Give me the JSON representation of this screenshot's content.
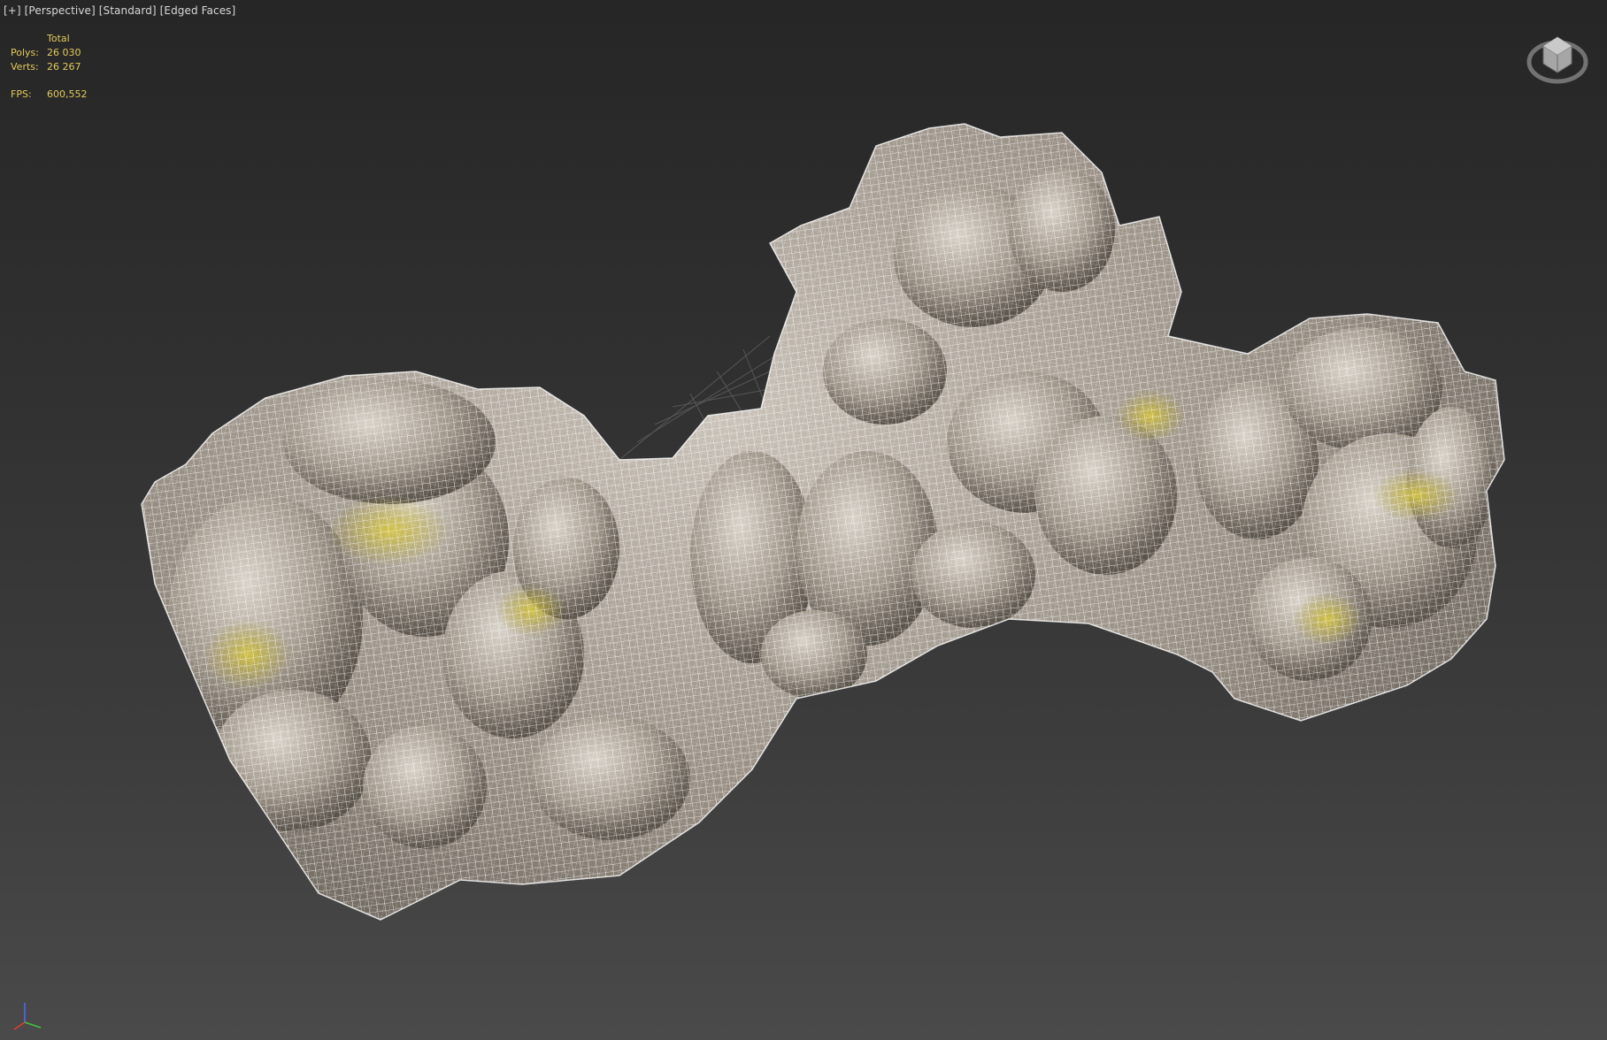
{
  "viewport": {
    "label_plus": "[+]",
    "label_view": "[Perspective]",
    "label_shading": "[Standard]",
    "label_display": "[Edged Faces]"
  },
  "stats": {
    "header": "Total",
    "polys_label": "Polys:",
    "polys_value": "26 030",
    "verts_label": "Verts:",
    "verts_value": "26 267",
    "fps_label": "FPS:",
    "fps_value": "600,552"
  },
  "colors": {
    "stats_text": "#e3c95a",
    "label_text": "#d8d8d8",
    "wire": "#ffffff",
    "rock_base": "#9a9288",
    "moss": "#c8b432",
    "axis_x": "#e0402a",
    "axis_y": "#3fc23f",
    "axis_z": "#4a6cff"
  },
  "icons": {
    "viewcube": "viewcube-icon",
    "axis": "axis-tripod-icon"
  }
}
